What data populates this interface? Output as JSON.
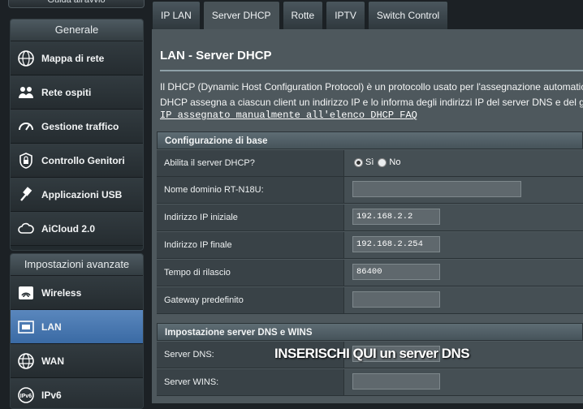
{
  "sidebar": {
    "top_stub": "Guida all'avvio",
    "general": {
      "header": "Generale",
      "items": [
        {
          "label": "Mappa di rete",
          "icon": "network-map-icon"
        },
        {
          "label": "Rete ospiti",
          "icon": "guest-network-icon"
        },
        {
          "label": "Gestione traffico",
          "icon": "traffic-manager-icon"
        },
        {
          "label": "Controllo Genitori",
          "icon": "parental-control-icon"
        },
        {
          "label": "Applicazioni USB",
          "icon": "usb-application-icon"
        },
        {
          "label": "AiCloud 2.0",
          "icon": "aicloud-icon"
        }
      ]
    },
    "advanced": {
      "header": "Impostazioni avanzate",
      "items": [
        {
          "label": "Wireless",
          "icon": "wireless-icon"
        },
        {
          "label": "LAN",
          "icon": "lan-icon",
          "active": true
        },
        {
          "label": "WAN",
          "icon": "wan-icon"
        },
        {
          "label": "IPv6",
          "icon": "ipv6-icon"
        }
      ]
    }
  },
  "tabs": [
    "IP LAN",
    "Server DHCP",
    "Rotte",
    "IPTV",
    "Switch Control"
  ],
  "active_tab": "Server DHCP",
  "page": {
    "title": "LAN - Server DHCP",
    "desc_line1": "Il DHCP (Dynamic Host Configuration Protocol) è un protocollo usato per l'assegnazione automatica deg",
    "desc_line2": "DHCP assegna a ciascun client un indirizzo IP e lo informa degli indirizzi IP del server DNS e del gatewa",
    "faq_link": "IP assegnato manualmente all'elenco DHCP FAQ"
  },
  "basic": {
    "header": "Configurazione di base",
    "enable_label": "Abilita il server DHCP?",
    "yes": "Sì",
    "no": "No",
    "domain_label": "Nome dominio RT-N18U:",
    "domain_value": "",
    "start_label": "Indirizzo IP iniziale",
    "start_value": "192.168.2.2",
    "end_label": "Indirizzo IP finale",
    "end_value": "192.168.2.254",
    "lease_label": "Tempo di rilascio",
    "lease_value": "86400",
    "gateway_label": "Gateway predefinito",
    "gateway_value": ""
  },
  "dns": {
    "header": "Impostazione server DNS e WINS",
    "dns_label": "Server DNS:",
    "dns_value": "",
    "wins_label": "Server WINS:",
    "wins_value": ""
  },
  "overlay_caption": "INSERISCHI QUI un server DNS",
  "colors": {
    "active_item": "#3a6aa4",
    "panel_bg": "#4e585d",
    "sidebar_bg": "#222a2e"
  }
}
